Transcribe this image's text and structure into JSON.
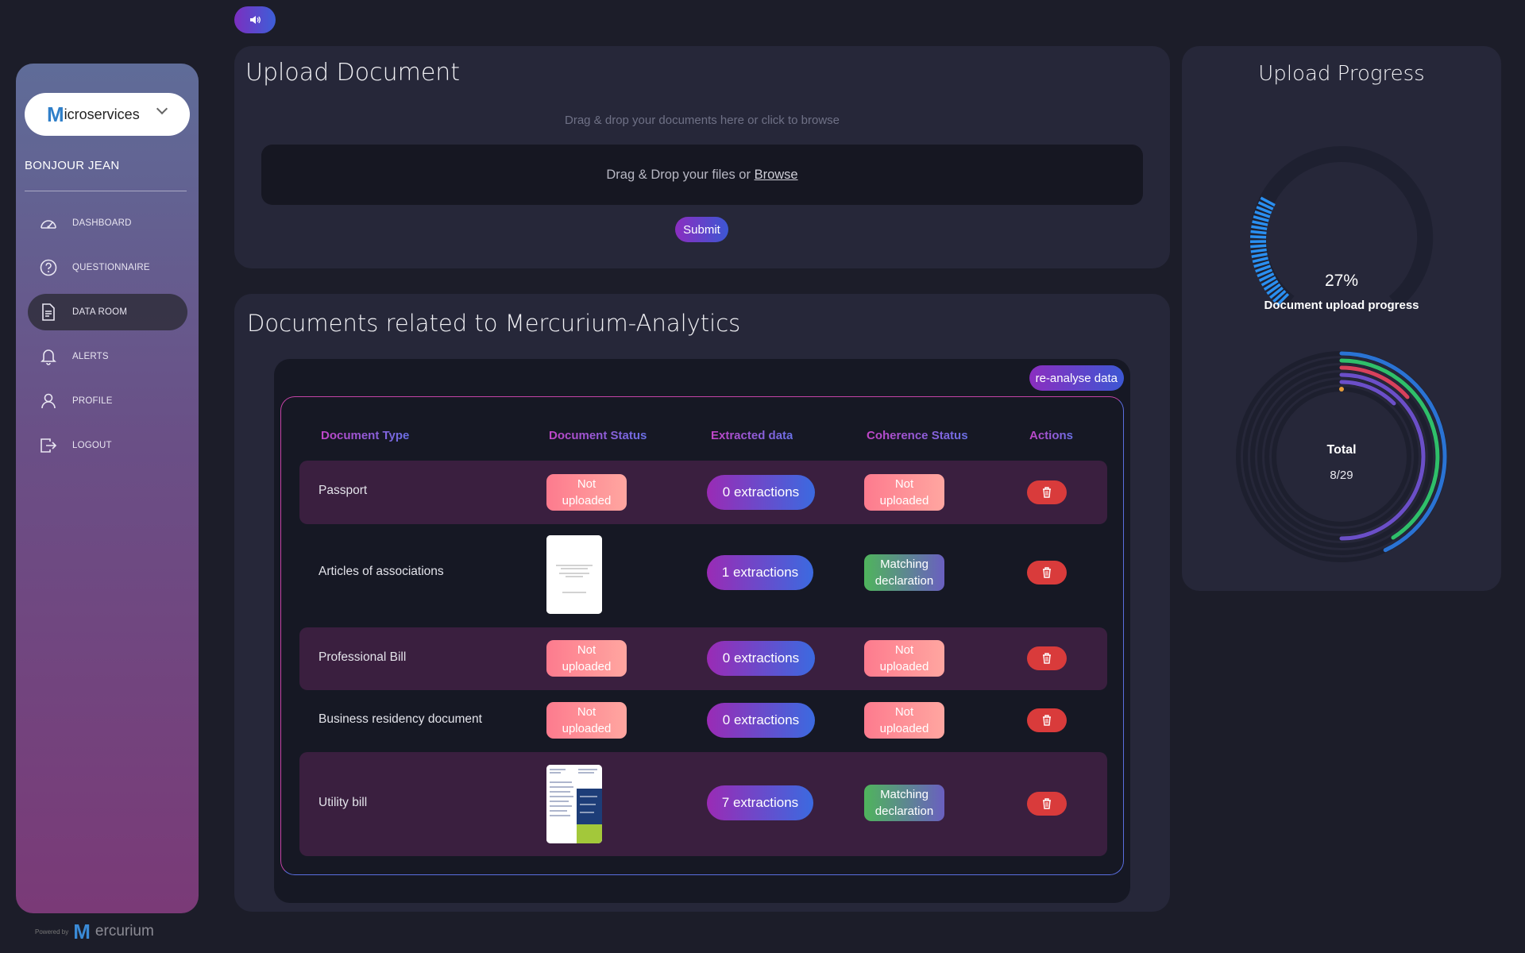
{
  "sidebar": {
    "brand_letter": "M",
    "brand_text": "icroservices",
    "greeting": "BONJOUR JEAN",
    "items": [
      {
        "label": "DASHBOARD",
        "icon": "gauge-icon"
      },
      {
        "label": "QUESTIONNAIRE",
        "icon": "question-icon"
      },
      {
        "label": "DATA ROOM",
        "icon": "document-icon",
        "active": true
      },
      {
        "label": "ALERTS",
        "icon": "bell-icon"
      },
      {
        "label": "PROFILE",
        "icon": "user-icon"
      },
      {
        "label": "LOGOUT",
        "icon": "logout-icon"
      }
    ]
  },
  "footer": {
    "powered_by": "Powered by",
    "brand_letter": "M",
    "brand_text": "ercurium"
  },
  "upload": {
    "title": "Upload Document",
    "hint": "Drag & drop your documents here or click to browse",
    "dropzone_text": "Drag & Drop your files or ",
    "browse_link": "Browse",
    "submit_label": "Submit"
  },
  "documents": {
    "title": "Documents related to Mercurium-Analytics",
    "reanalyse_label": "re-analyse data",
    "columns": [
      "Document Type",
      "Document Status",
      "Extracted data",
      "Coherence Status",
      "Actions"
    ],
    "rows": [
      {
        "type": "Passport",
        "status": "Not uploaded",
        "extractions": "0 extractions",
        "coherence": "Not uploaded"
      },
      {
        "type": "Articles of associations",
        "status": "thumbnail",
        "extractions": "1 extractions",
        "coherence": "Matching declaration"
      },
      {
        "type": "Professional Bill",
        "status": "Not uploaded",
        "extractions": "0 extractions",
        "coherence": "Not uploaded"
      },
      {
        "type": "Business residency document",
        "status": "Not uploaded",
        "extractions": "0 extractions",
        "coherence": "Not uploaded"
      },
      {
        "type": "Utility bill",
        "status": "thumbnail",
        "extractions": "7 extractions",
        "coherence": "Matching declaration"
      }
    ],
    "status_not_uploaded_l1": "Not",
    "status_not_uploaded_l2": "uploaded",
    "coherence_match_l1": "Matching",
    "coherence_match_l2": "declaration"
  },
  "progress": {
    "title": "Upload Progress",
    "percent": "27%",
    "percent_value": 27,
    "percent_label": "Document upload progress",
    "total_label": "Total",
    "total_value": "8/29"
  },
  "colors": {
    "accent_purple": "#8b2ec0",
    "accent_blue": "#3c57d3",
    "danger": "#d93b3b",
    "arc_blue": "#2a73d4",
    "arc_green": "#2fbf6a",
    "arc_red": "#d8415c",
    "arc_purple": "#6b4fc8",
    "arc_orange": "#e79c3a"
  }
}
